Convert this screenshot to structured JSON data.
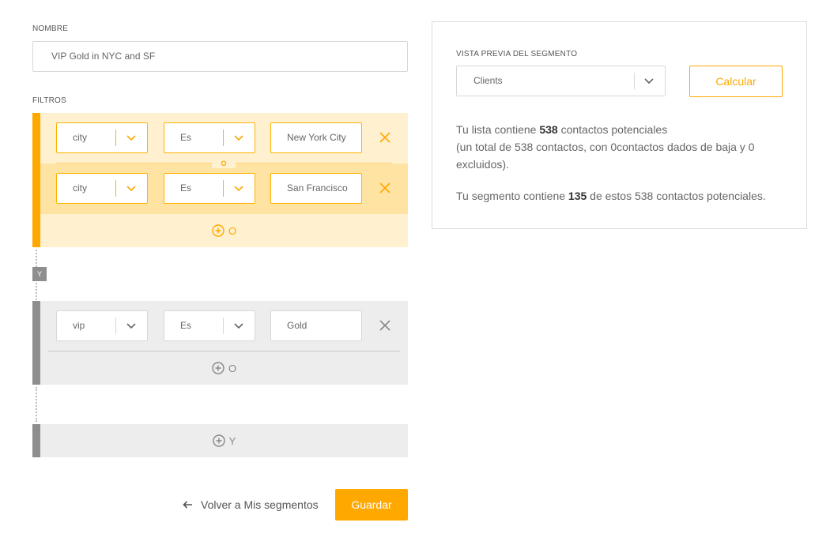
{
  "form": {
    "name_label": "NOMBRE",
    "name_value": "VIP Gold in NYC and SF",
    "filters_label": "FILTROS"
  },
  "filter_groups": [
    {
      "color": "#ffa800",
      "rows": [
        {
          "field": "city",
          "operator": "Es",
          "value": "New York City"
        },
        {
          "field": "city",
          "operator": "Es",
          "value": "San Francisco"
        }
      ],
      "or_badge": "O",
      "add_label": "O"
    },
    {
      "color": "#8e8e8e",
      "rows": [
        {
          "field": "vip",
          "operator": "Es",
          "value": "Gold"
        }
      ],
      "add_label": "O"
    }
  ],
  "and_badge": "Y",
  "add_and_label": "Y",
  "footer": {
    "back_label": "Volver a Mis segmentos",
    "save_label": "Guardar"
  },
  "preview": {
    "label": "VISTA PREVIA DEL SEGMENTO",
    "list_value": "Clients",
    "calc_label": "Calcular",
    "list_line1_pre": "Tu lista contiene ",
    "list_count": "538",
    "list_line1_post": " contactos potenciales",
    "list_line2": "(un total de 538 contactos, con 0contactos dados de baja y 0 excluidos).",
    "segment_pre": "Tu segmento contiene ",
    "segment_count": "135",
    "segment_post": " de estos 538 contactos potenciales."
  },
  "colors": {
    "accent": "#ffa800",
    "gray": "#8e8e8e"
  },
  "icons": [
    "chevron-down-icon",
    "close-icon",
    "plus-circle-icon",
    "arrow-left-icon"
  ]
}
